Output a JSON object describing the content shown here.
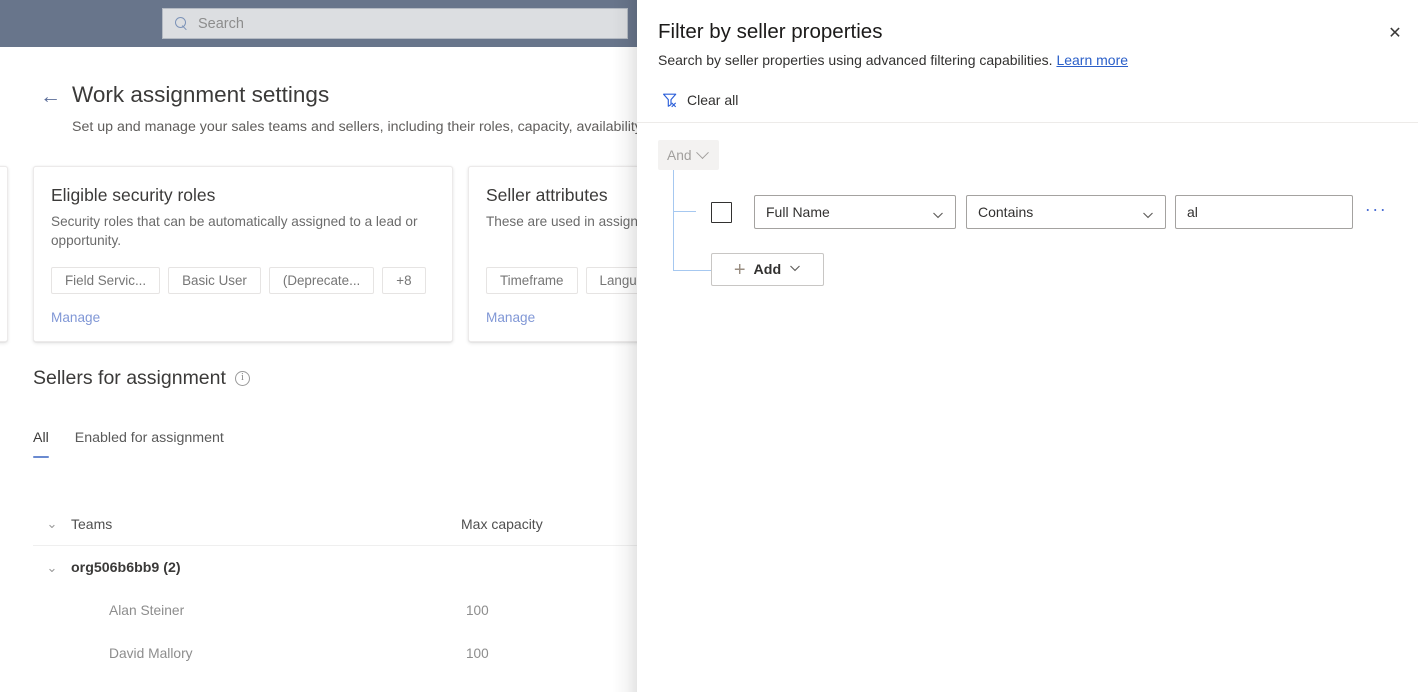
{
  "app": {
    "topbar": {
      "search": {
        "icon": "search-icon",
        "placeholder": "Search",
        "value": ""
      }
    },
    "page": {
      "back_icon": "back-arrow-icon",
      "title": "Work assignment settings",
      "subtitle": "Set up and manage your sales teams and sellers, including their roles, capacity, availability a",
      "cards": [
        {
          "title": "Eligible security roles",
          "description": "Security roles that can be automatically assigned to a lead or opportunity.",
          "chips": [
            "Field Servic...",
            "Basic User",
            "(Deprecate...",
            "+8"
          ],
          "link": "Manage"
        },
        {
          "title": "Seller attributes",
          "description": "These are used in assign",
          "chips": [
            "Timeframe",
            "Languag"
          ],
          "link": "Manage"
        }
      ],
      "sellers_section": {
        "title": "Sellers for assignment",
        "info_icon": "info-icon",
        "tabs": [
          {
            "label": "All",
            "active": true
          },
          {
            "label": "Enabled for assignment",
            "active": false
          }
        ],
        "table": {
          "columns": [
            "Teams",
            "Max capacity"
          ],
          "group": {
            "label": "org506b6bb9 (2)",
            "expand_icon": "chevron-down-icon"
          },
          "rows": [
            {
              "name": "Alan Steiner",
              "max_capacity": "100"
            },
            {
              "name": "David Mallory",
              "max_capacity": "100"
            }
          ]
        }
      }
    }
  },
  "panel": {
    "title": "Filter by seller properties",
    "close_icon": "close-icon",
    "close_label": "✕",
    "description": "Search by seller properties using advanced filtering capabilities.",
    "learn_more": "Learn more",
    "clear_all": {
      "label": "Clear all",
      "icon": "filter-clear-icon"
    },
    "builder": {
      "conjunction": {
        "value": "And",
        "icon": "chevron-down-icon"
      },
      "row": {
        "checkbox_checked": false,
        "field": {
          "value": "Full Name",
          "icon": "chevron-down-icon"
        },
        "operator": {
          "value": "Contains",
          "icon": "chevron-down-icon"
        },
        "value": {
          "value": "al",
          "placeholder": ""
        },
        "more_icon": "ellipsis-icon",
        "more_label": "···"
      },
      "add_button": {
        "label": "Add",
        "plus": "+",
        "icon": "chevron-down-icon"
      }
    }
  },
  "colors": {
    "topbar": "#68758b",
    "accent_link": "#2a5fc9",
    "connector": "#a6c8f0",
    "tab_underline": "#6a8ad0",
    "manage_link": "#8097d6"
  }
}
